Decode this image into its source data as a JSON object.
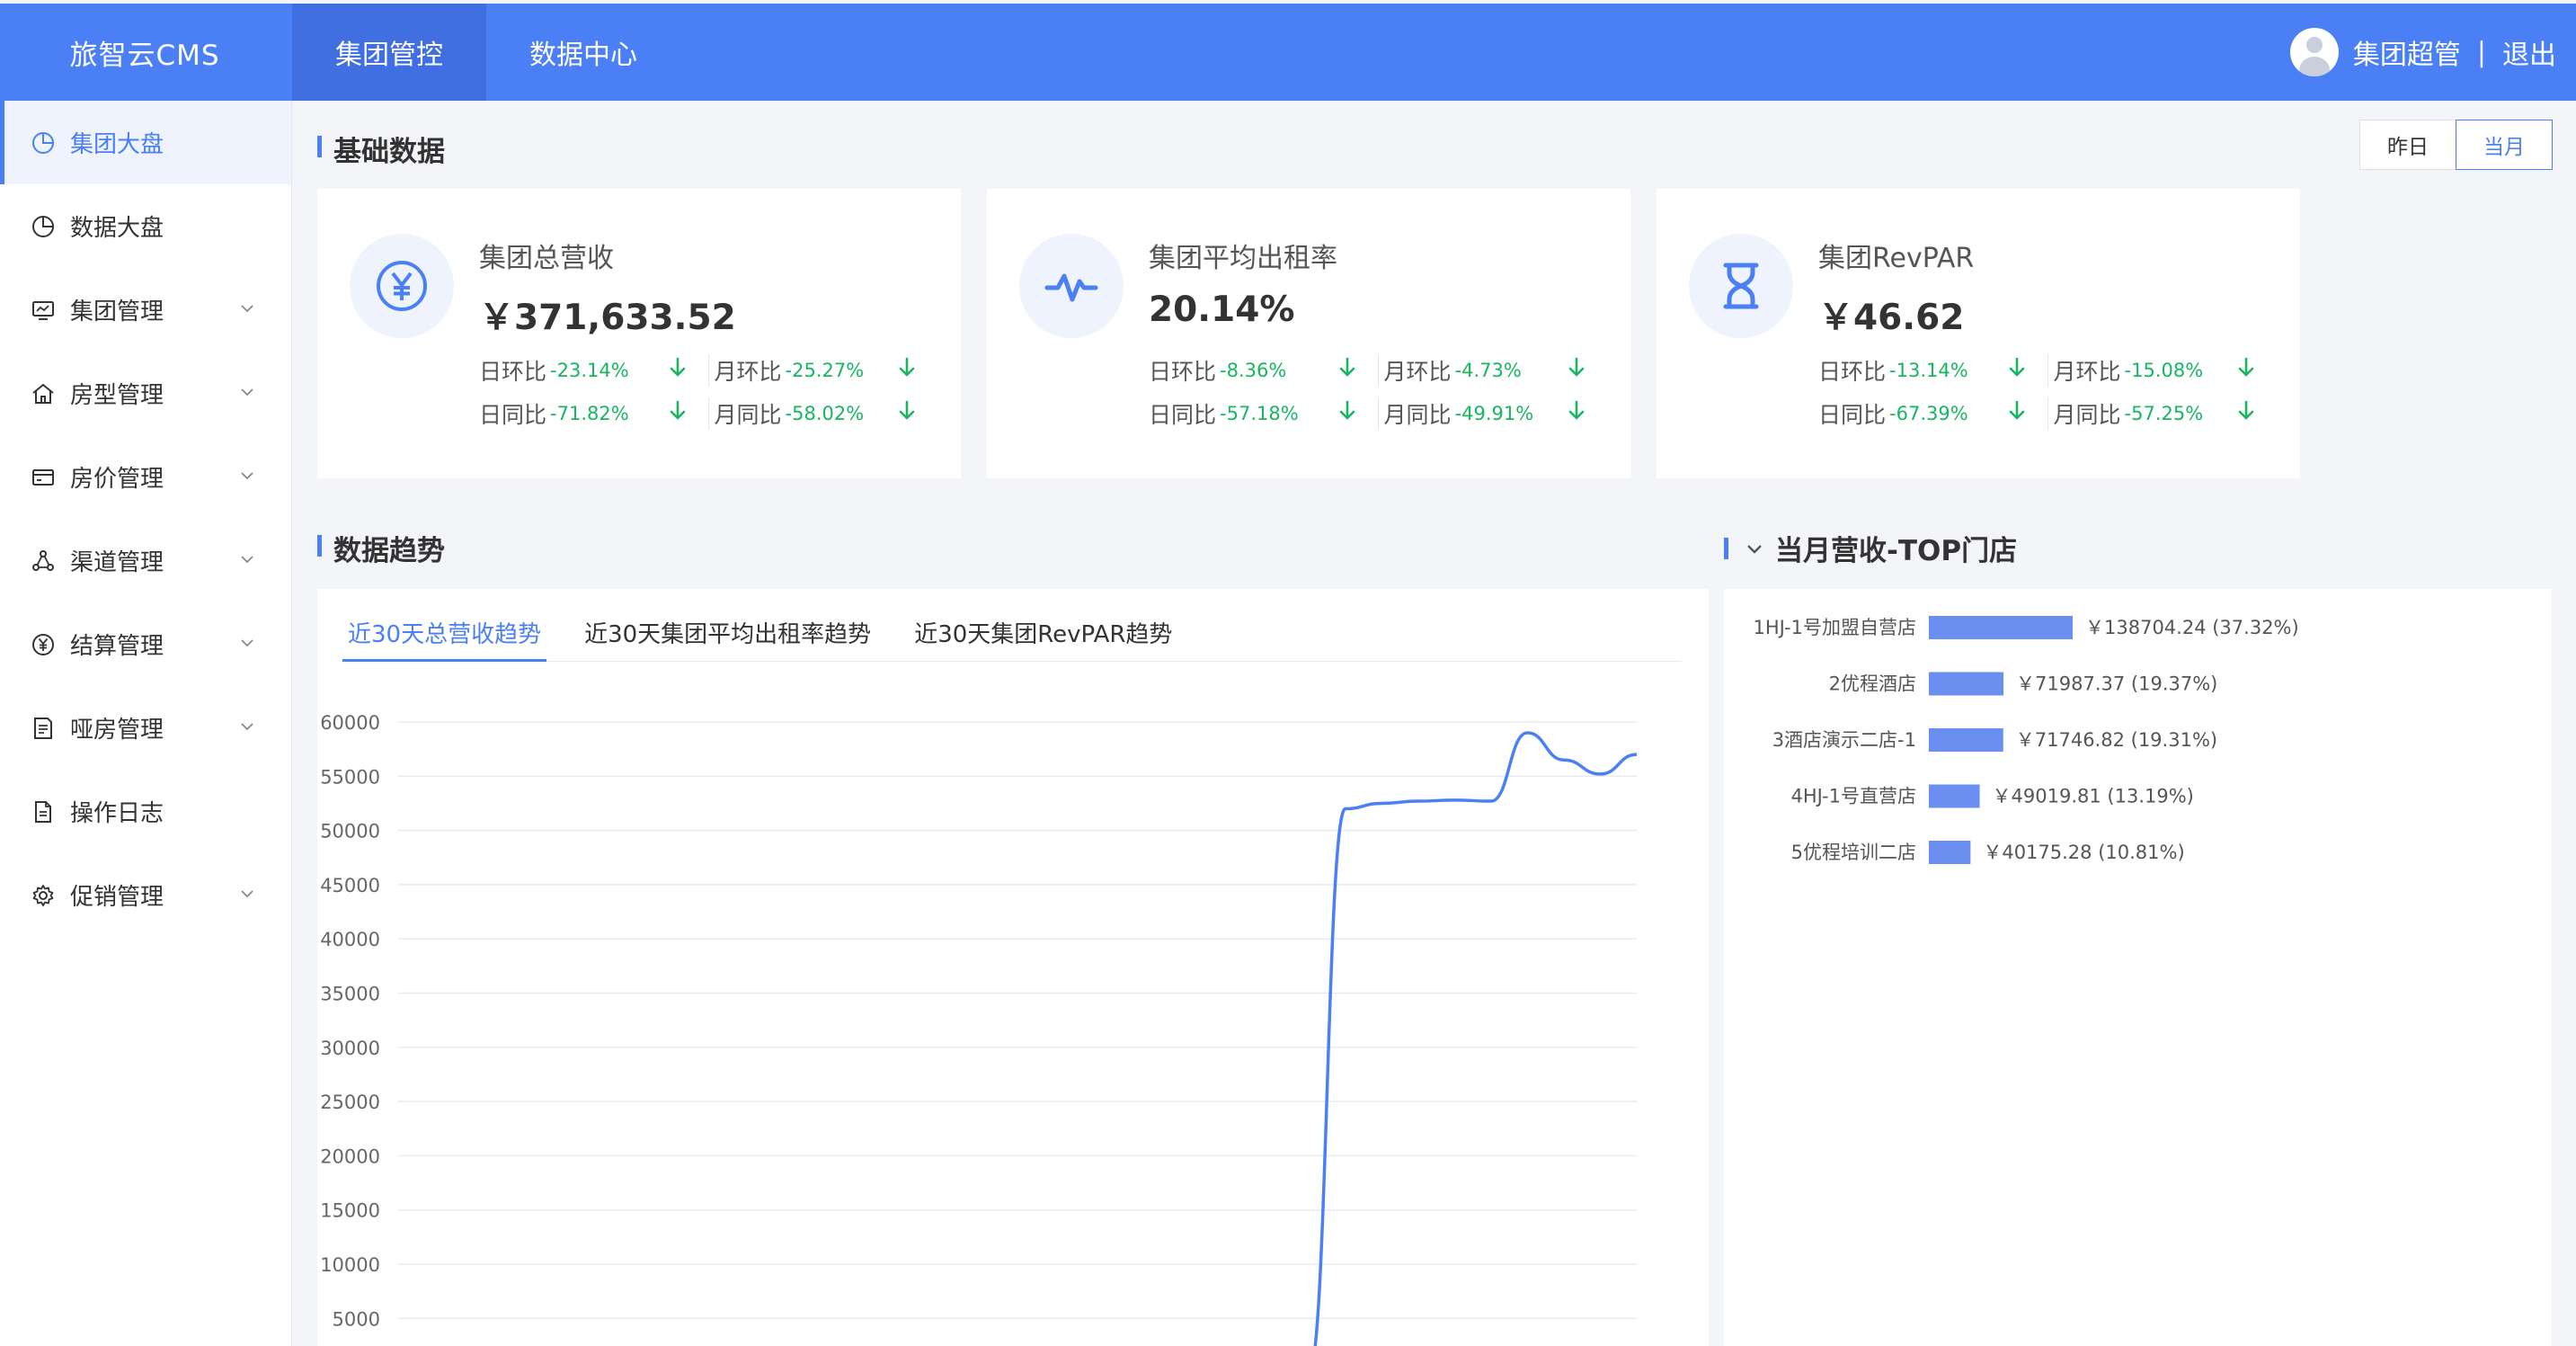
{
  "header": {
    "brand": "旅智云CMS",
    "nav": [
      "集团管控",
      "数据中心"
    ],
    "user_name": "集团超管",
    "separator": "|",
    "logout": "退出"
  },
  "sidebar": {
    "items": [
      {
        "label": "集团大盘",
        "icon": "pie-chart-icon",
        "expandable": false,
        "active": true
      },
      {
        "label": "数据大盘",
        "icon": "pie-chart-icon",
        "expandable": false,
        "active": false
      },
      {
        "label": "集团管理",
        "icon": "monitor-chart-icon",
        "expandable": true,
        "active": false
      },
      {
        "label": "房型管理",
        "icon": "home-icon",
        "expandable": true,
        "active": false
      },
      {
        "label": "房价管理",
        "icon": "card-icon",
        "expandable": true,
        "active": false
      },
      {
        "label": "渠道管理",
        "icon": "network-icon",
        "expandable": true,
        "active": false
      },
      {
        "label": "结算管理",
        "icon": "yen-circle-icon",
        "expandable": true,
        "active": false
      },
      {
        "label": "哑房管理",
        "icon": "document-list-icon",
        "expandable": true,
        "active": false
      },
      {
        "label": "操作日志",
        "icon": "document-icon",
        "expandable": false,
        "active": false
      },
      {
        "label": "促销管理",
        "icon": "gear-icon",
        "expandable": true,
        "active": false
      }
    ]
  },
  "basic": {
    "title": "基础数据",
    "range_buttons": [
      "昨日",
      "当月"
    ],
    "active_range": "当月"
  },
  "kpis": [
    {
      "icon": "yen-icon",
      "label": "集团总营收",
      "value": "￥371,633.52",
      "cmp": [
        {
          "label": "日环比",
          "pct": "-23.14%"
        },
        {
          "label": "月环比",
          "pct": "-25.27%"
        },
        {
          "label": "日同比",
          "pct": "-71.82%"
        },
        {
          "label": "月同比",
          "pct": "-58.02%"
        }
      ]
    },
    {
      "icon": "pulse-icon",
      "label": "集团平均出租率",
      "value": "20.14%",
      "cmp": [
        {
          "label": "日环比",
          "pct": "-8.36%"
        },
        {
          "label": "月环比",
          "pct": "-4.73%"
        },
        {
          "label": "日同比",
          "pct": "-57.18%"
        },
        {
          "label": "月同比",
          "pct": "-49.91%"
        }
      ]
    },
    {
      "icon": "hourglass-icon",
      "label": "集团RevPAR",
      "value": "￥46.62",
      "cmp": [
        {
          "label": "日环比",
          "pct": "-13.14%"
        },
        {
          "label": "月环比",
          "pct": "-15.08%"
        },
        {
          "label": "日同比",
          "pct": "-67.39%"
        },
        {
          "label": "月同比",
          "pct": "-57.25%"
        }
      ]
    }
  ],
  "trend": {
    "title": "数据趋势",
    "tabs": [
      "近30天总营收趋势",
      "近30天集团平均出租率趋势",
      "近30天集团RevPAR趋势"
    ],
    "active_tab": 0
  },
  "top": {
    "title": "当月营收-TOP门店"
  },
  "colors": {
    "primary": "#4b7ff6",
    "bar": "#6a8ff1",
    "down": "#18b660"
  },
  "chart_data": [
    {
      "type": "line",
      "y_ticks": [
        5000,
        10000,
        15000,
        20000,
        25000,
        30000,
        35000,
        40000,
        45000,
        50000,
        55000,
        60000
      ],
      "ylim": [
        0,
        60000
      ],
      "grid": true,
      "series": [
        {
          "values": [
            0,
            0,
            0,
            0,
            0,
            0,
            0,
            0,
            0,
            0,
            0,
            0,
            0,
            0,
            0,
            0,
            0,
            0,
            0,
            0,
            0,
            0,
            0,
            0,
            0,
            0,
            52000,
            52500,
            52700,
            52800,
            52700,
            59000,
            56500,
            55200,
            57000
          ]
        }
      ]
    },
    {
      "type": "bar",
      "orientation": "horizontal",
      "categories": [
        "1HJ-1号加盟自营店",
        "2优程酒店",
        "3酒店演示二店-1",
        "4HJ-1号直营店",
        "5优程培训二店"
      ],
      "values": [
        138704.24,
        71987.37,
        71746.82,
        49019.81,
        40175.28
      ],
      "labels": [
        "￥138704.24 (37.32%)",
        "￥71987.37 (19.37%)",
        "￥71746.82 (19.31%)",
        "￥49019.81 (13.19%)",
        "￥40175.28 (10.81%)"
      ]
    }
  ]
}
